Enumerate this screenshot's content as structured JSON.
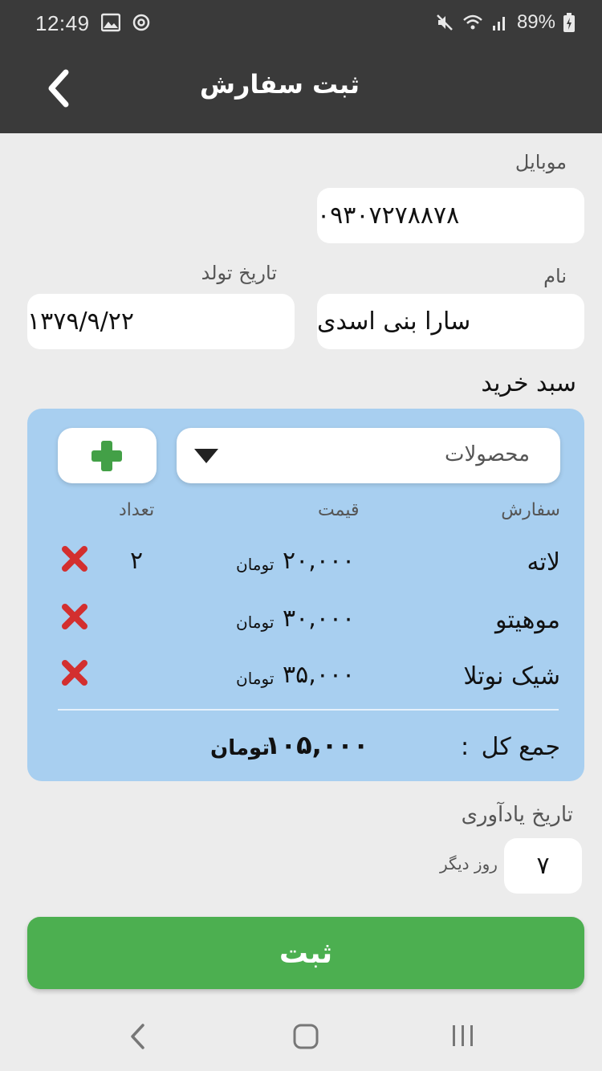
{
  "status": {
    "time": "12:49",
    "battery": "89%",
    "icons": [
      "image-icon",
      "sync-icon",
      "mute-icon",
      "wifi-icon",
      "signal-icon",
      "battery-icon"
    ]
  },
  "appbar": {
    "title": "ثبت سفارش",
    "back_icon": "chevron-left-icon"
  },
  "form": {
    "mobile_label": "موبایل",
    "mobile_value": "۰۹۳۰۷۲۷۸۸۷۸",
    "name_label": "نام",
    "name_value": "سارا بنی اسدی",
    "birth_label": "تاریخ تولد",
    "birth_value": "۱۳۷۹/۹/۲۲"
  },
  "cart": {
    "title": "سبد خرید",
    "dropdown_label": "محصولات",
    "add_icon": "plus-icon",
    "columns": {
      "order": "سفارش",
      "price": "قیمت",
      "qty": "تعداد"
    },
    "items": [
      {
        "name": "لاته",
        "price": "۲۰,۰۰۰",
        "currency": "تومان",
        "qty": "۲"
      },
      {
        "name": "موهیتو",
        "price": "۳۰,۰۰۰",
        "currency": "تومان",
        "qty": ""
      },
      {
        "name": "شیک نوتلا",
        "price": "۳۵,۰۰۰",
        "currency": "تومان",
        "qty": ""
      }
    ],
    "total_label": "جمع کل",
    "total_colon": ":",
    "total_value": "۱۰۵,۰۰۰",
    "total_currency": "تومان"
  },
  "reminder": {
    "label": "تاریخ یادآوری",
    "value": "۷",
    "unit": "روز دیگر"
  },
  "submit_label": "ثبت",
  "colors": {
    "appbar": "#3a3a3a",
    "cart_bg": "#a8cff0",
    "accent_green": "#4caf50",
    "delete_red": "#d32f2f"
  },
  "navbar": [
    "back-nav-icon",
    "home-nav-icon",
    "recents-nav-icon"
  ]
}
